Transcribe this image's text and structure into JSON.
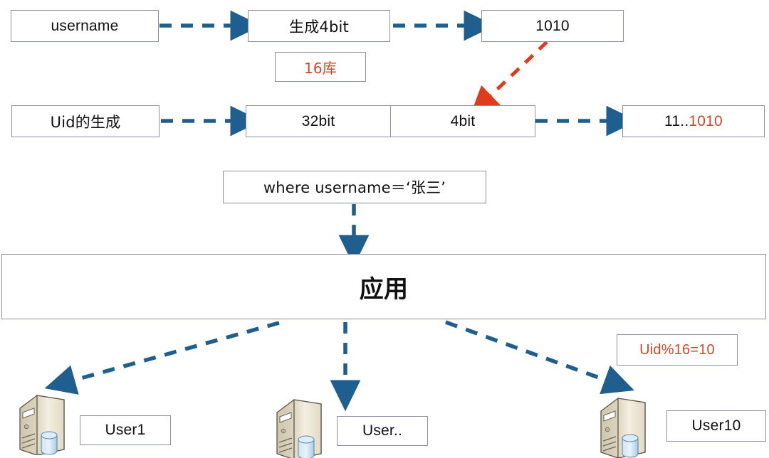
{
  "diagram": {
    "title": "Uid sharding routing diagram",
    "colors": {
      "box_border": "#8d8fab",
      "blue_arrow": "#1f5f8f",
      "red_arrow": "#e03c1c",
      "red_text": "#d3452a",
      "text": "#111111",
      "server_body": "#efe9d8",
      "db_cylinder": "#b6d4ec"
    },
    "boxes": {
      "username": "username",
      "generate_4bit": "生成4bit",
      "sixteen_db": "16库",
      "binary_1010": "1010",
      "uid_generation": "Uid的生成",
      "bits_32": "32bit",
      "bits_4": "4bit",
      "uid_value_prefix": "11..",
      "uid_value_suffix": "1010",
      "where_clause": "where username＝‘张三’",
      "application": "应用",
      "uid_mod": "Uid%16=10",
      "user1": "User1",
      "user_dots": "User..",
      "user10": "User10"
    },
    "icons": {
      "server1": "server-icon",
      "server2": "server-icon",
      "server3": "server-icon"
    },
    "arrows": [
      {
        "name": "username-to-generate4bit",
        "style": "dashed",
        "color": "#1f5f8f"
      },
      {
        "name": "generate4bit-to-1010",
        "style": "dashed",
        "color": "#1f5f8f"
      },
      {
        "name": "1010-to-4bit",
        "style": "dashed",
        "color": "#e03c1c"
      },
      {
        "name": "uidgen-to-32bit",
        "style": "dashed",
        "color": "#1f5f8f"
      },
      {
        "name": "4bit-to-uidvalue",
        "style": "dashed",
        "color": "#1f5f8f"
      },
      {
        "name": "where-to-application",
        "style": "dashed",
        "color": "#1f5f8f"
      },
      {
        "name": "application-to-user1",
        "style": "dashed",
        "color": "#1f5f8f"
      },
      {
        "name": "application-to-userdots",
        "style": "dashed",
        "color": "#1f5f8f"
      },
      {
        "name": "application-to-user10",
        "style": "dashed",
        "color": "#1f5f8f"
      }
    ]
  }
}
